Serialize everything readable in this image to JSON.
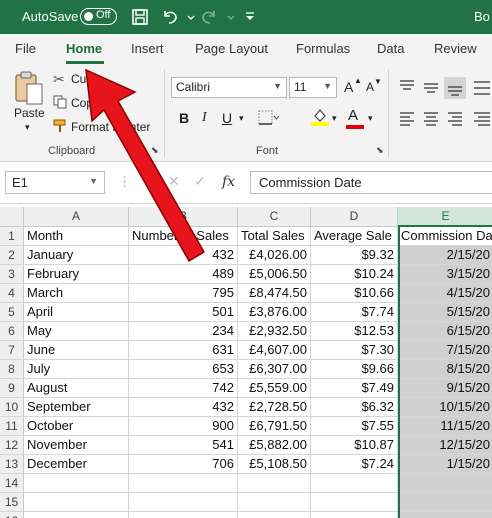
{
  "titlebar": {
    "autosave_label": "AutoSave",
    "toggle_state": "Off",
    "book_name": "Bo"
  },
  "tabs": [
    {
      "label": "File"
    },
    {
      "label": "Home"
    },
    {
      "label": "Insert"
    },
    {
      "label": "Page Layout"
    },
    {
      "label": "Formulas"
    },
    {
      "label": "Data"
    },
    {
      "label": "Review"
    }
  ],
  "active_tab": "Home",
  "ribbon": {
    "clipboard": {
      "group_label": "Clipboard",
      "paste_label": "Paste",
      "cut_label": "Cut",
      "copy_label": "Copy",
      "format_painter_label": "Format Painter"
    },
    "font": {
      "group_label": "Font",
      "font_name": "Calibri",
      "font_size": "11",
      "bold": "B",
      "italic": "I",
      "underline": "U",
      "grow_font": "A",
      "shrink_font": "A",
      "font_color_letter": "A"
    },
    "colors": {
      "highlight": "#ffff00",
      "font_color": "#e00000",
      "brand": "#217346"
    }
  },
  "formula_bar": {
    "name_box": "E1",
    "fx_label": "fx",
    "formula": "Commission Date"
  },
  "grid": {
    "column_headers": [
      "A",
      "B",
      "C",
      "D",
      "E"
    ],
    "selected_column": "E",
    "row_headers": [
      "1",
      "2",
      "3",
      "4",
      "5",
      "6",
      "7",
      "8",
      "9",
      "10",
      "11",
      "12",
      "13",
      "14",
      "15",
      "16"
    ],
    "rows": [
      [
        "Month",
        "Number of Sales",
        "Total Sales",
        "Average Sale",
        "Commission Da"
      ],
      [
        "January",
        "432",
        "£4,026.00",
        "$9.32",
        "2/15/20"
      ],
      [
        "February",
        "489",
        "£5,006.50",
        "$10.24",
        "3/15/20"
      ],
      [
        "March",
        "795",
        "£8,474.50",
        "$10.66",
        "4/15/20"
      ],
      [
        "April",
        "501",
        "£3,876.00",
        "$7.74",
        "5/15/20"
      ],
      [
        "May",
        "234",
        "£2,932.50",
        "$12.53",
        "6/15/20"
      ],
      [
        "June",
        "631",
        "£4,607.00",
        "$7.30",
        "7/15/20"
      ],
      [
        "July",
        "653",
        "£6,307.00",
        "$9.66",
        "8/15/20"
      ],
      [
        "August",
        "742",
        "£5,559.00",
        "$7.49",
        "9/15/20"
      ],
      [
        "September",
        "432",
        "£2,728.50",
        "$6.32",
        "10/15/20"
      ],
      [
        "October",
        "900",
        "£6,791.50",
        "$7.55",
        "11/15/20"
      ],
      [
        "November",
        "541",
        "£5,882.00",
        "$10.87",
        "12/15/20"
      ],
      [
        "December",
        "706",
        "£5,108.50",
        "$7.24",
        "1/15/20"
      ],
      [
        "",
        "",
        "",
        "",
        ""
      ],
      [
        "",
        "",
        "",
        "",
        ""
      ],
      [
        "",
        "",
        "",
        "",
        ""
      ]
    ]
  }
}
